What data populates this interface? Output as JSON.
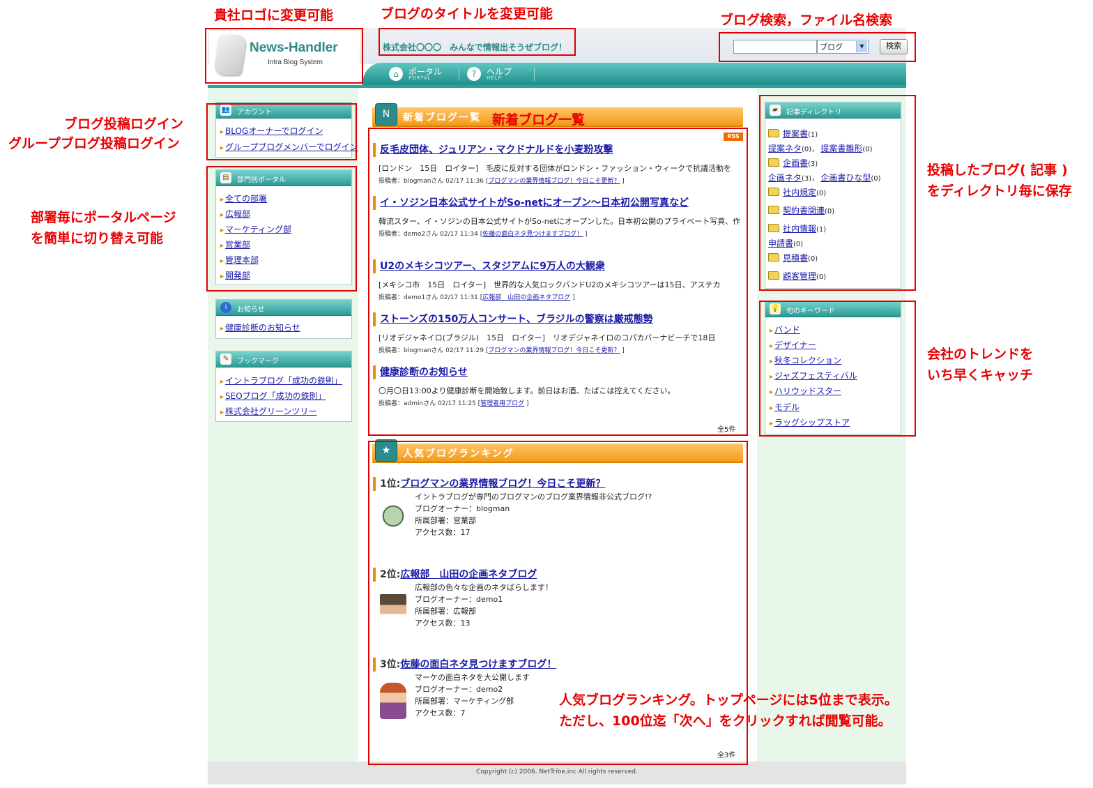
{
  "header": {
    "logo_title": "News-Handler",
    "logo_sub": "Intra Blog System",
    "blog_title": "株式会社〇〇〇　みんなで情報出そうぜブログ！",
    "search": {
      "input_value": "",
      "select_value": "ブログ",
      "button": "検索"
    }
  },
  "nav": [
    {
      "label": "ポータル",
      "sub": "PORTAL",
      "icon": "home-icon"
    },
    {
      "label": "ヘルプ",
      "sub": "HELP",
      "icon": "question-icon"
    }
  ],
  "left": {
    "account": {
      "title": "アカウント",
      "items": [
        "BLOGオーナーでログイン",
        "グループブログメンバーでログイン"
      ]
    },
    "dept": {
      "title": "部門別ポータル",
      "items": [
        "全ての部署",
        "広報部",
        "マーケティング部",
        "営業部",
        "管理本部",
        "開発部"
      ]
    },
    "notice": {
      "title": "お知らせ",
      "items": [
        "健康診断のお知らせ"
      ]
    },
    "bookmark": {
      "title": "ブックマーク",
      "items": [
        "イントラブログ「成功の鉄則」",
        "SEOブログ「成功の鉄則」",
        "株式会社グリーンツリー"
      ]
    }
  },
  "center": {
    "new_title": "新着ブログ一覧",
    "rss": "RSS",
    "entries": [
      {
        "title": "反毛皮団体、ジュリアン・マクドナルドを小麦粉攻撃",
        "body": "[ロンドン　15日　ロイター]　毛皮に反対する団体がロンドン・ファッション・ウィークで抗議活動を",
        "meta": "投稿者：blogmanさん 02/17 11:36 [",
        "link": "ブログマンの業界情報ブログ！今日こそ更新？",
        "end": " ]"
      },
      {
        "title": "イ・ソジン日本公式サイトがSo-netにオープン〜日本初公開写真など",
        "body": "韓流スター、イ・ソジンの日本公式サイトがSo-netにオープンした。日本初公開のプライベート写真、作",
        "meta": "投稿者：demo2さん 02/17 11:34 [",
        "link": "佐藤の面白ネタ見つけますブログ！",
        "end": " ]"
      },
      {
        "title": "U2のメキシコツアー、スタジアムに9万人の大観衆",
        "body": "[メキシコ市　15日　ロイター]　世界的な人気ロックバンドU2のメキシコツアーは15日、アステカ",
        "meta": "投稿者：demo1さん 02/17 11:31 [",
        "link": "広報部　山田の企画ネタブログ",
        "end": " ]"
      },
      {
        "title": "ストーンズの150万人コンサート、ブラジルの警察は厳戒態勢",
        "body": "[リオデジャネイロ(ブラジル)　15日　ロイター]　リオデジャネイロのコパカバーナビーチで18日",
        "meta": "投稿者：blogmanさん 02/17 11:29 [",
        "link": "ブログマンの業界情報ブログ！今日こそ更新？",
        "end": " ]"
      },
      {
        "title": "健康診断のお知らせ",
        "body": "〇月〇日13:00より健康診断を開始致します。前日はお酒、たばこは控えてください。",
        "meta": "投稿者：adminさん 02/17 11:25 [",
        "link": "管理者用ブログ",
        "end": " ]"
      }
    ],
    "new_total": "全5件",
    "ranking_title": "人気ブログランキング",
    "ranking": [
      {
        "rank": "1位:",
        "name": "ブログマンの業界情報ブログ！今日こそ更新？",
        "lines": [
          "イントラブログが専門のブログマンのブログ業界情報非公式ブログ!?",
          "ブログオーナー：blogman",
          "所属部署：営業部",
          "アクセス数：17"
        ]
      },
      {
        "rank": "2位:",
        "name": "広報部　山田の企画ネタブログ",
        "lines": [
          "広報部の色々な企画のネタばらします！",
          "ブログオーナー：demo1",
          "所属部署：広報部",
          "アクセス数：13"
        ]
      },
      {
        "rank": "3位:",
        "name": "佐藤の面白ネタ見つけますブログ！",
        "lines": [
          "マーケの面白ネタを大公開します",
          "ブログオーナー：demo2",
          "所属部署：マーケティング部",
          "アクセス数：7"
        ]
      }
    ],
    "ranking_total": "全3件"
  },
  "right": {
    "dir": {
      "title": "記事ディレクトリ",
      "rows": [
        {
          "folder": true,
          "items": [
            {
              "name": "提案書",
              "count": "(1)"
            }
          ]
        },
        {
          "folder": false,
          "items": [
            {
              "name": "提案ネタ",
              "count": "(0)，"
            },
            {
              "name": "提案書雛形",
              "count": "(0)"
            }
          ]
        },
        {
          "folder": true,
          "items": [
            {
              "name": "企画書",
              "count": "(3)"
            }
          ]
        },
        {
          "folder": false,
          "items": [
            {
              "name": "企画ネタ",
              "count": "(3)，"
            },
            {
              "name": "企画書ひな型",
              "count": "(0)"
            }
          ]
        },
        {
          "folder": true,
          "items": [
            {
              "name": "社内規定",
              "count": "(0)"
            }
          ]
        },
        {
          "folder": true,
          "items": [
            {
              "name": "契約書関連",
              "count": "(0)"
            }
          ]
        },
        {
          "folder": true,
          "items": [
            {
              "name": "社内情報",
              "count": "(1)"
            }
          ]
        },
        {
          "folder": false,
          "items": [
            {
              "name": "申請書",
              "count": "(0)"
            }
          ]
        },
        {
          "folder": true,
          "items": [
            {
              "name": "見積書",
              "count": "(0)"
            }
          ]
        },
        {
          "folder": true,
          "items": [
            {
              "name": "顧客管理",
              "count": "(0)"
            }
          ]
        }
      ]
    },
    "keywords": {
      "title": "旬のキーワード",
      "items": [
        "バンド",
        "デザイナー",
        "秋冬コレクション",
        "ジャズフェスティバル",
        "ハリウッドスター",
        "モデル",
        "ラッグシップストア"
      ]
    }
  },
  "footer": {
    "copyright": "Copyright (c) 2006. NetTribe.inc All rights reserved."
  },
  "annotations": {
    "logo": "貴社ロゴに変更可能",
    "title": "ブログのタイトルを変更可能",
    "search": "ブログ検索，ファイル名検索",
    "login1": "ブログ投稿ログイン",
    "login2": "グループブログ投稿ログイン",
    "portal1": "部署毎にポータルページ",
    "portal2": "を簡単に切り替え可能",
    "newlist": "新着ブログ一覧",
    "dir1": "投稿したブログ( 記事 )",
    "dir2": "をディレクトリ毎に保存",
    "trend1": "会社のトレンドを",
    "trend2": "いち早くキャッチ",
    "rank1": "人気ブログランキング。トップページには5位まで表示。",
    "rank2": "ただし、100位迄「次へ」をクリックすれば閲覧可能。"
  },
  "colors": {
    "accent_teal": "#2a9a95",
    "accent_orange": "#f39a18",
    "annotation_red": "#e00000",
    "link": "#1a1aa8"
  }
}
